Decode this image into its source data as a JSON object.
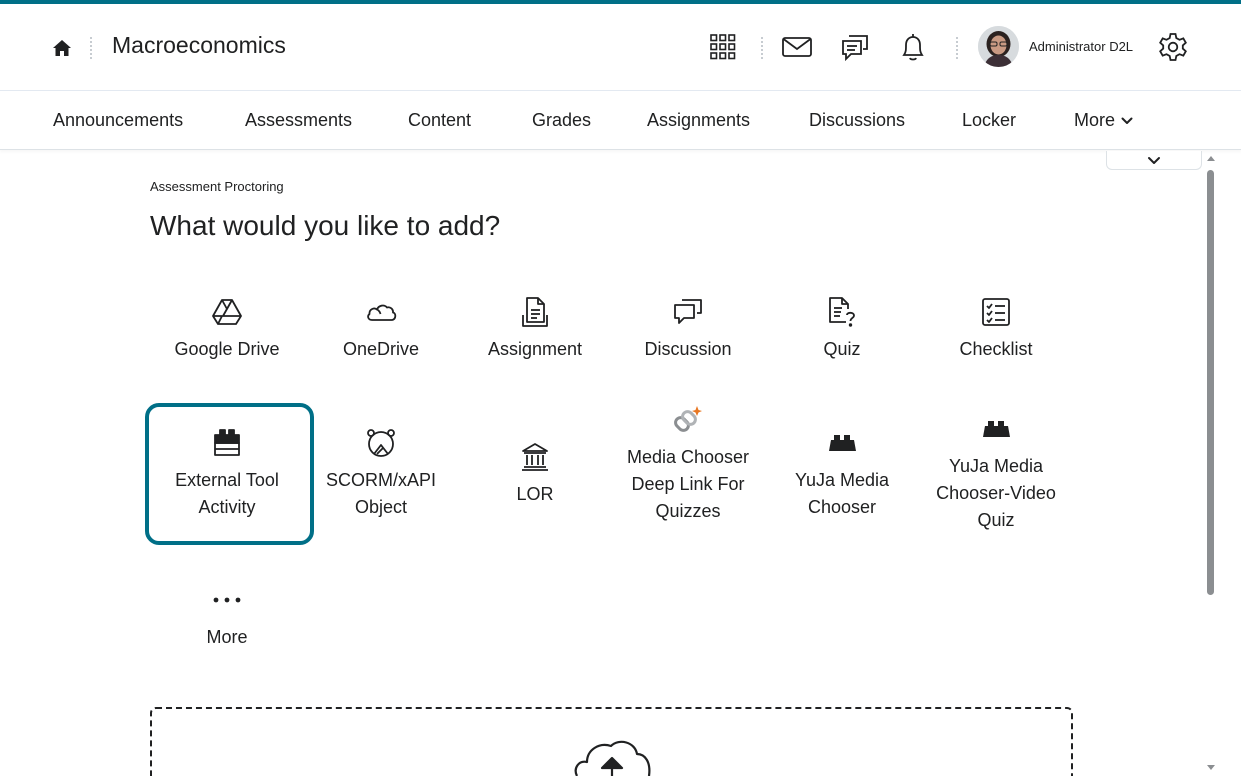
{
  "header": {
    "course_title": "Macroeconomics",
    "user_name": "Administrator D2L",
    "icons": [
      "home-icon",
      "grid-icon",
      "mail-icon",
      "chat-icon",
      "bell-icon",
      "gear-icon"
    ]
  },
  "nav": {
    "items": [
      {
        "label": "Announcements"
      },
      {
        "label": "Assessments"
      },
      {
        "label": "Content"
      },
      {
        "label": "Grades"
      },
      {
        "label": "Assignments"
      },
      {
        "label": "Discussions"
      },
      {
        "label": "Locker"
      },
      {
        "label": "More"
      }
    ]
  },
  "main": {
    "breadcrumb": "Assessment Proctoring",
    "heading": "What would you like to add?",
    "tiles": [
      {
        "label": "Google Drive",
        "icon": "google-drive-icon"
      },
      {
        "label": "OneDrive",
        "icon": "onedrive-icon"
      },
      {
        "label": "Assignment",
        "icon": "assignment-icon"
      },
      {
        "label": "Discussion",
        "icon": "discussion-icon"
      },
      {
        "label": "Quiz",
        "icon": "quiz-icon"
      },
      {
        "label": "Checklist",
        "icon": "checklist-icon"
      },
      {
        "label": "External Tool Activity",
        "icon": "external-tool-icon"
      },
      {
        "label": "SCORM/xAPI Object",
        "icon": "scorm-icon"
      },
      {
        "label": "LOR",
        "icon": "lor-icon"
      },
      {
        "label": "Media Chooser Deep Link For Quizzes",
        "icon": "media-chooser-icon"
      },
      {
        "label": "YuJa Media Chooser",
        "icon": "yuja-block-icon"
      },
      {
        "label": "YuJa Media Chooser-Video Quiz",
        "icon": "yuja-block-icon"
      },
      {
        "label": "More",
        "icon": "ellipsis-icon"
      }
    ],
    "selected_tile": "External Tool Activity"
  },
  "colors": {
    "accent": "#006f87",
    "text": "#202122",
    "media_chooser_spark": "#e87722"
  }
}
